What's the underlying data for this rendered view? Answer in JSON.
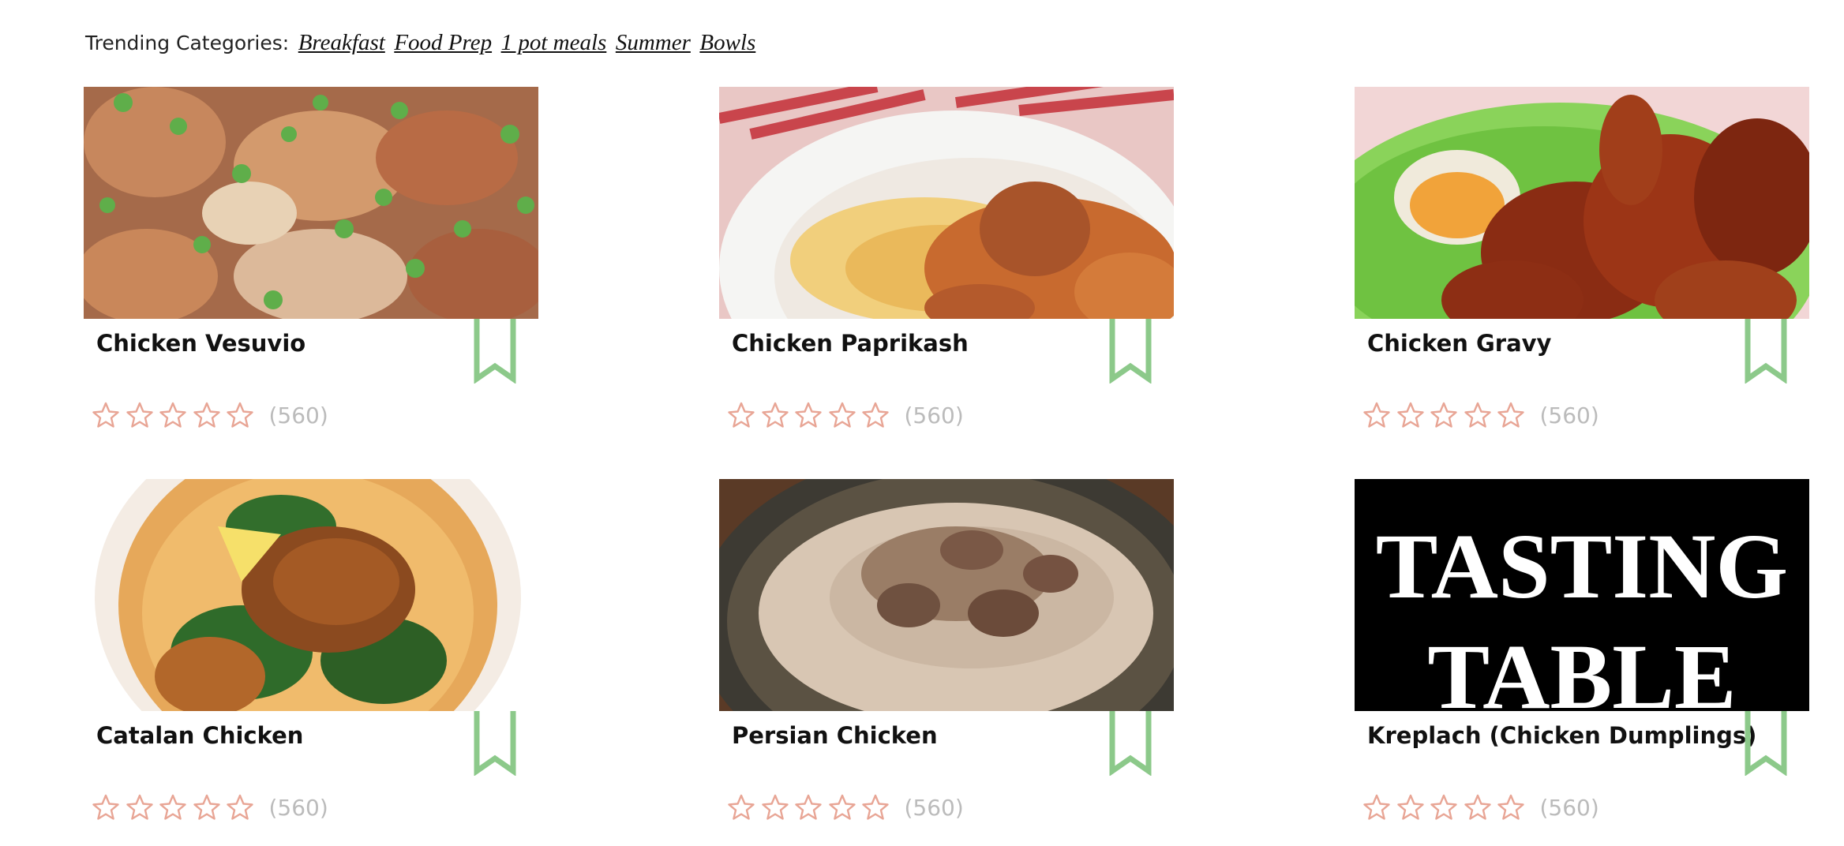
{
  "trending": {
    "label": "Trending Categories:",
    "categories": [
      "Breakfast",
      "Food Prep",
      "1 pot meals",
      "Summer",
      "Bowls"
    ]
  },
  "colors": {
    "bookmark": "#8cc98a",
    "star": "#e8a595",
    "count": "#bbbbbb"
  },
  "recipes": [
    {
      "title": "Chicken Vesuvio",
      "rating_count": "(560)",
      "image": "roast chicken with peas"
    },
    {
      "title": "Chicken Paprikash",
      "rating_count": "(560)",
      "image": "chicken paprikash with noodles"
    },
    {
      "title": "Chicken Gravy",
      "rating_count": "(560)",
      "image": "fried chicken on green plate"
    },
    {
      "title": "Catalan Chicken",
      "rating_count": "(560)",
      "image": "chicken in broth with lemon"
    },
    {
      "title": "Persian Chicken",
      "rating_count": "(560)",
      "image": "chicken over rice"
    },
    {
      "title": "Kreplach (Chicken Dumplings)",
      "rating_count": "(560)",
      "image": "Tasting Table logo",
      "logo_text": [
        "TASTING",
        "TABLE"
      ]
    }
  ]
}
